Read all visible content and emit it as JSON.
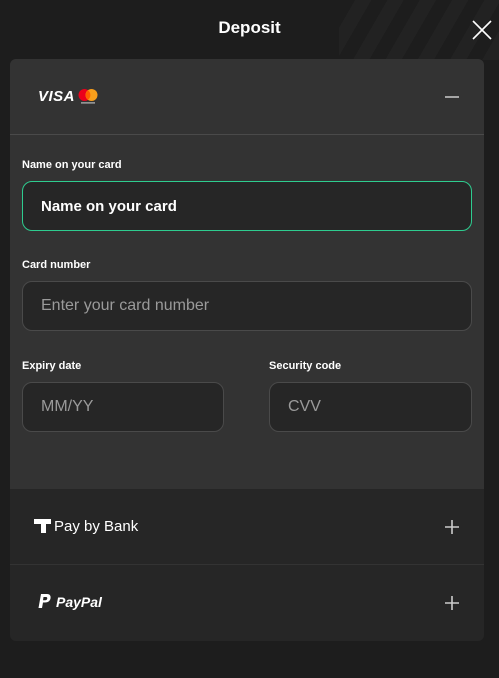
{
  "header": {
    "title": "Deposit"
  },
  "card": {
    "brand_visa": "VISA",
    "fields": {
      "name": {
        "label": "Name on your card",
        "value": "Name on your card"
      },
      "number": {
        "label": "Card number",
        "placeholder": "Enter your card number"
      },
      "expiry": {
        "label": "Expiry date",
        "placeholder": "MM/YY"
      },
      "cvv": {
        "label": "Security code",
        "placeholder": "CVV"
      }
    }
  },
  "methods": {
    "bank": {
      "label": "Pay by Bank"
    },
    "paypal": {
      "label": "PayPal"
    }
  },
  "colors": {
    "background": "#1d1d1d",
    "panel": "#333333",
    "input_bg": "#262626",
    "accent_focus": "#2ecc8f"
  }
}
